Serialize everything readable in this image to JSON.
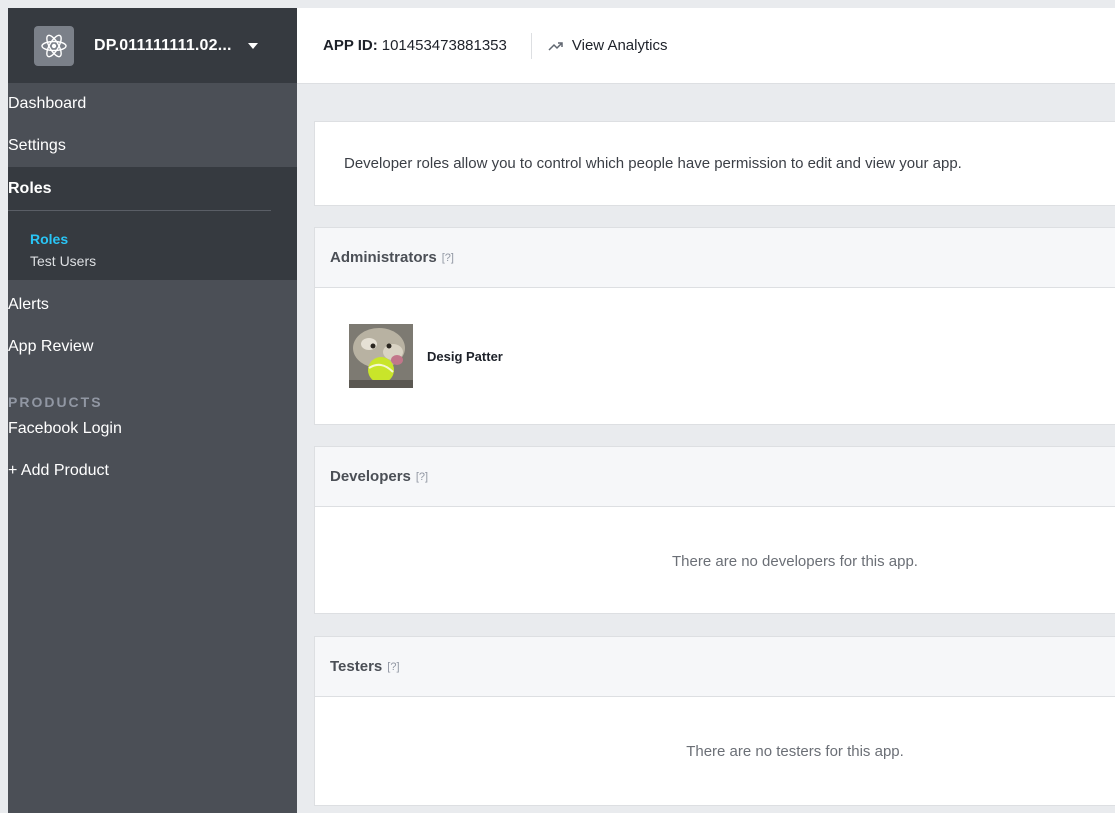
{
  "sidebar": {
    "app_name": "DP.011111111.02...",
    "app_icon": "atom-icon",
    "items": [
      {
        "label": "Dashboard"
      },
      {
        "label": "Settings"
      },
      {
        "label": "Roles"
      },
      {
        "label": "Alerts"
      },
      {
        "label": "App Review"
      }
    ],
    "subitems": [
      {
        "label": "Roles"
      },
      {
        "label": "Test Users"
      }
    ],
    "products_label": "PRODUCTS",
    "products": [
      {
        "label": "Facebook Login"
      },
      {
        "label": "+ Add Product"
      }
    ]
  },
  "topbar": {
    "app_id_label": "APP ID:",
    "app_id_value": "101453473881353",
    "analytics_label": "View Analytics",
    "analytics_icon": "trend-up-icon"
  },
  "intro": {
    "text": "Developer roles allow you to control which people have permission to edit and view your app."
  },
  "administrators": {
    "title": "Administrators",
    "help": "[?]",
    "members": [
      {
        "name": "Desig Patter"
      }
    ]
  },
  "developers": {
    "title": "Developers",
    "help": "[?]",
    "empty": "There are no developers for this app."
  },
  "testers": {
    "title": "Testers",
    "help": "[?]",
    "empty": "There are no testers for this app."
  },
  "colors": {
    "sidebar_bg": "#4b4f56",
    "sidebar_active_bg": "#363a40",
    "accent": "#29c5f6",
    "page_bg": "#e9ebee"
  }
}
